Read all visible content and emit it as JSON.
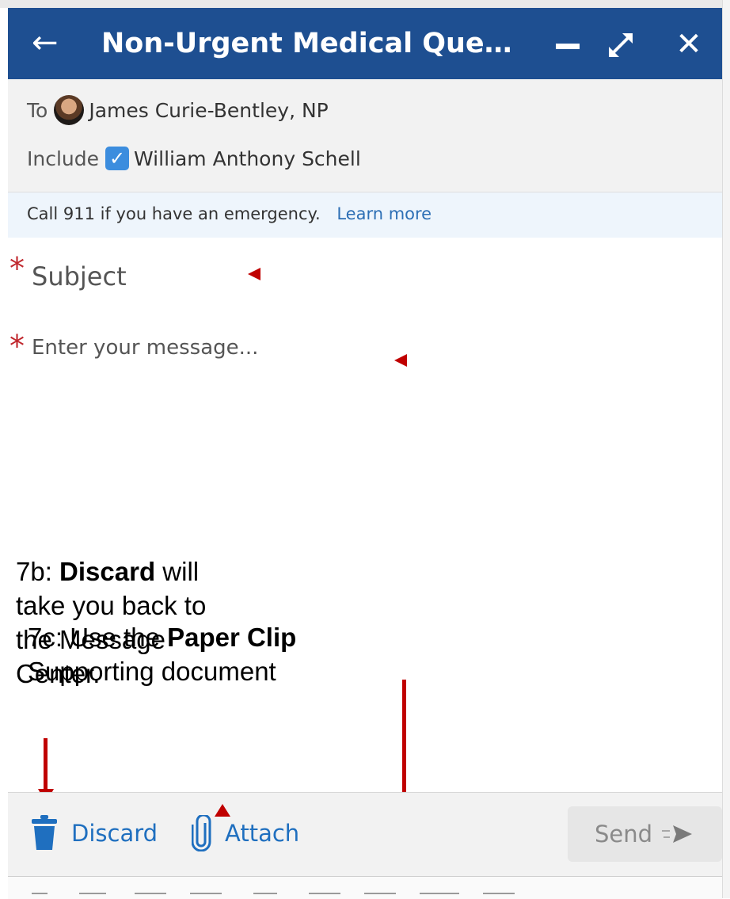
{
  "window": {
    "title": "Non-Urgent Medical Que…",
    "back_icon": "arrow-left-icon",
    "minimize_icon": "minimize-icon",
    "expand_icon": "expand-icon",
    "close_icon": "close-icon",
    "colors": {
      "titlebar": "#1e4f91",
      "title_text": "#ffffff"
    }
  },
  "recipient": {
    "to_label": "To",
    "name": "James Curie-Bentley, NP"
  },
  "include": {
    "label": "Include",
    "name": "William Anthony Schell",
    "checked": true
  },
  "banner": {
    "text": "Call 911 if you have an emergency.",
    "link": "Learn more"
  },
  "form": {
    "required_marker": "*",
    "subject_placeholder": "Subject",
    "message_placeholder": "Enter your message..."
  },
  "annotations": {
    "discard_note": {
      "prefix": "7b: ",
      "bold": "Discard",
      "rest_line1": " will",
      "line2": "take you back to",
      "line3": "the Message",
      "line4": "Center."
    },
    "attach_note": {
      "prefix": "7c: Use the ",
      "bold": "Paper Clip",
      "line2": "Supporting document"
    },
    "arrow_color": "#c00000"
  },
  "footer": {
    "discard_label": "Discard",
    "attach_label": "Attach",
    "send_label": "Send"
  }
}
